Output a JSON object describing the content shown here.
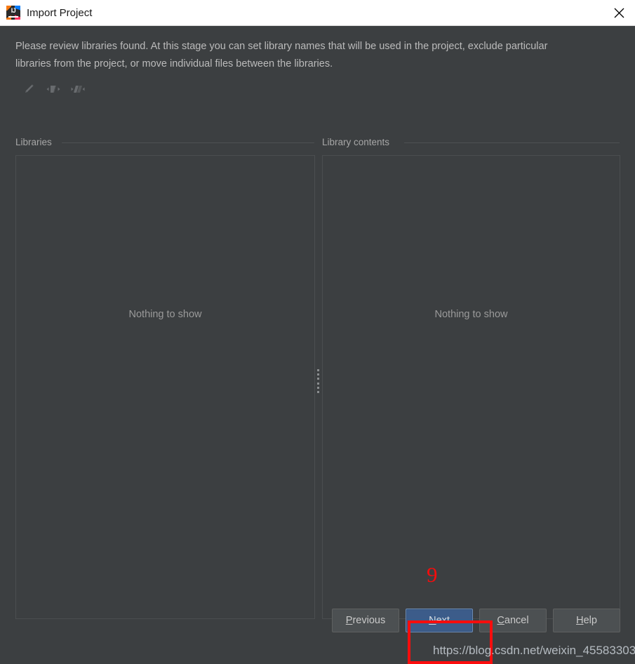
{
  "window": {
    "title": "Import Project",
    "app_icon": "intellij-idea-icon",
    "close_icon": "close-icon"
  },
  "content": {
    "description": "Please review libraries found. At this stage you can set library names that will be used in the project, exclude particular libraries from the project, or move individual files between the libraries."
  },
  "toolbar": {
    "items": [
      {
        "name": "edit-pencil-icon",
        "tooltip": "Rename"
      },
      {
        "name": "merge-libraries-icon",
        "tooltip": "Merge"
      },
      {
        "name": "split-library-icon",
        "tooltip": "Split"
      }
    ]
  },
  "panels": {
    "left": {
      "label": "Libraries",
      "empty_text": "Nothing to show"
    },
    "right": {
      "label": "Library contents",
      "empty_text": "Nothing to show"
    }
  },
  "splitter": {
    "name": "panel-splitter"
  },
  "buttons": {
    "previous": {
      "label": "Previous",
      "mnemonic": "P"
    },
    "next": {
      "label": "Next",
      "mnemonic": "N"
    },
    "cancel": {
      "label": "Cancel",
      "mnemonic": "C"
    },
    "help": {
      "label": "Help",
      "mnemonic": "H"
    }
  },
  "annotations": {
    "step_number": "9",
    "highlight_target": "next-button",
    "highlight_color": "#fb0d0d"
  },
  "watermark": {
    "text": "https://blog.csdn.net/weixin_45583303"
  },
  "colors": {
    "dialog_background": "#3c3f41",
    "titlebar_background": "#ffffff",
    "panel_border": "#4b4e50",
    "primary_button": "#3c5c8a",
    "annotation_red": "#fb0d0d"
  }
}
